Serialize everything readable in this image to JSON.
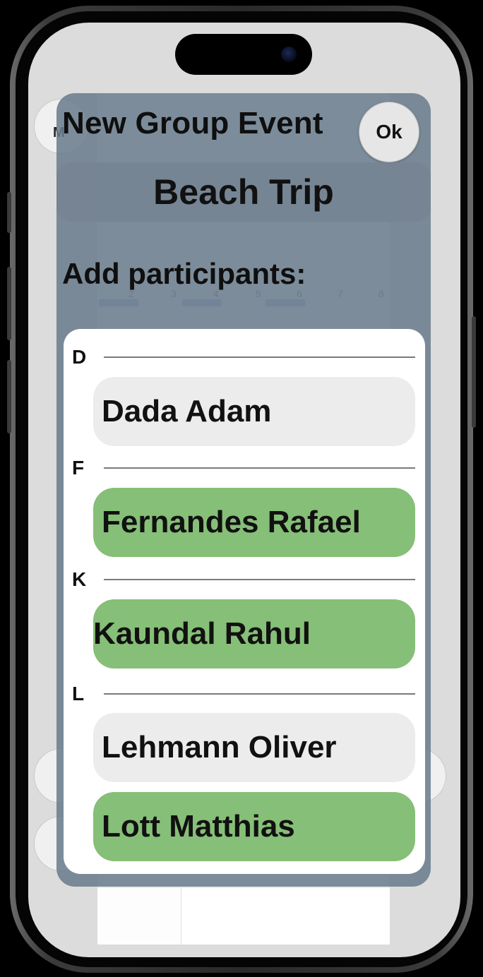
{
  "background_app": {
    "round_button_label": "M"
  },
  "dialog": {
    "title": "New Group Event",
    "ok_label": "Ok",
    "event_name": "Beach Trip",
    "participants_label": "Add participants:"
  },
  "participants": {
    "sections": [
      {
        "letter": "D",
        "people": [
          {
            "name": "Dada Adam",
            "selected": false
          }
        ]
      },
      {
        "letter": "F",
        "people": [
          {
            "name": "Fernandes Rafael",
            "selected": true
          }
        ]
      },
      {
        "letter": "K",
        "people": [
          {
            "name": "Kaundal Rahul",
            "selected": true
          }
        ]
      },
      {
        "letter": "L",
        "people": [
          {
            "name": "Lehmann Oliver",
            "selected": false
          },
          {
            "name": "Lott Matthias",
            "selected": true
          }
        ]
      }
    ]
  },
  "colors": {
    "selected": "#86bf77",
    "unselected": "#ececec",
    "dialog_overlay": "#697c8c"
  }
}
